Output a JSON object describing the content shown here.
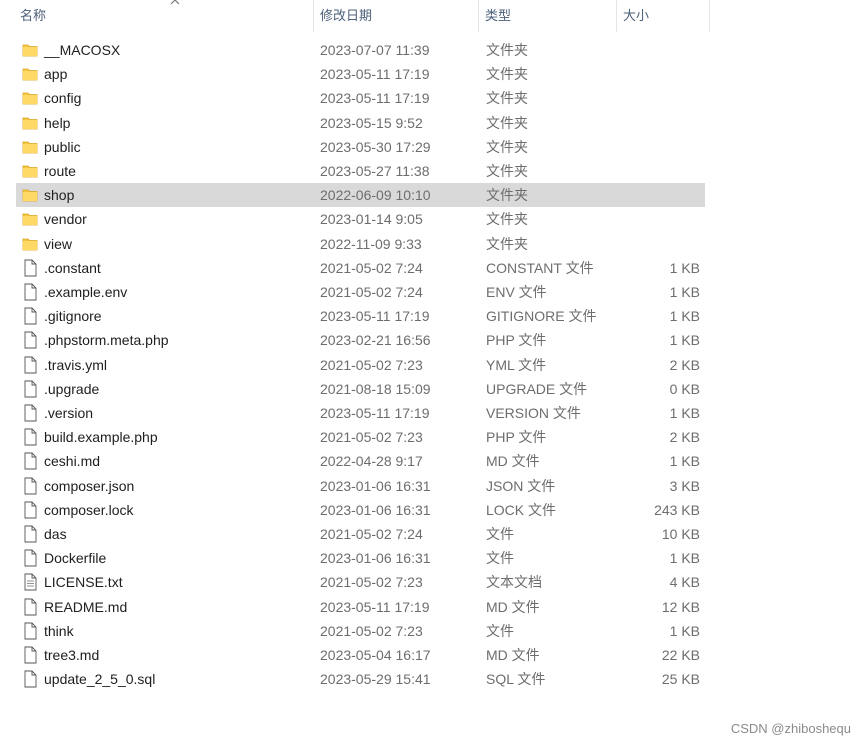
{
  "header": {
    "name": "名称",
    "date": "修改日期",
    "type": "类型",
    "size": "大小"
  },
  "colors": {
    "folder": "#f5c542",
    "selected_row": "#d9d9d9",
    "header_text": "#4c607a"
  },
  "files": [
    {
      "name": "__MACOSX",
      "date": "2023-07-07 11:39",
      "type": "文件夹",
      "size": "",
      "icon": "folder-icon"
    },
    {
      "name": "app",
      "date": "2023-05-11 17:19",
      "type": "文件夹",
      "size": "",
      "icon": "folder-icon"
    },
    {
      "name": "config",
      "date": "2023-05-11 17:19",
      "type": "文件夹",
      "size": "",
      "icon": "folder-icon"
    },
    {
      "name": "help",
      "date": "2023-05-15 9:52",
      "type": "文件夹",
      "size": "",
      "icon": "folder-icon"
    },
    {
      "name": "public",
      "date": "2023-05-30 17:29",
      "type": "文件夹",
      "size": "",
      "icon": "folder-icon"
    },
    {
      "name": "route",
      "date": "2023-05-27 11:38",
      "type": "文件夹",
      "size": "",
      "icon": "folder-icon"
    },
    {
      "name": "shop",
      "date": "2022-06-09 10:10",
      "type": "文件夹",
      "size": "",
      "icon": "folder-icon",
      "selected": true
    },
    {
      "name": "vendor",
      "date": "2023-01-14 9:05",
      "type": "文件夹",
      "size": "",
      "icon": "folder-icon"
    },
    {
      "name": "view",
      "date": "2022-11-09 9:33",
      "type": "文件夹",
      "size": "",
      "icon": "folder-icon"
    },
    {
      "name": ".constant",
      "date": "2021-05-02 7:24",
      "type": "CONSTANT 文件",
      "size": "1 KB",
      "icon": "file-icon"
    },
    {
      "name": ".example.env",
      "date": "2021-05-02 7:24",
      "type": "ENV 文件",
      "size": "1 KB",
      "icon": "file-icon"
    },
    {
      "name": ".gitignore",
      "date": "2023-05-11 17:19",
      "type": "GITIGNORE 文件",
      "size": "1 KB",
      "icon": "file-icon"
    },
    {
      "name": ".phpstorm.meta.php",
      "date": "2023-02-21 16:56",
      "type": "PHP 文件",
      "size": "1 KB",
      "icon": "file-icon"
    },
    {
      "name": ".travis.yml",
      "date": "2021-05-02 7:23",
      "type": "YML 文件",
      "size": "2 KB",
      "icon": "file-icon"
    },
    {
      "name": ".upgrade",
      "date": "2021-08-18 15:09",
      "type": "UPGRADE 文件",
      "size": "0 KB",
      "icon": "file-icon"
    },
    {
      "name": ".version",
      "date": "2023-05-11 17:19",
      "type": "VERSION 文件",
      "size": "1 KB",
      "icon": "file-icon"
    },
    {
      "name": "build.example.php",
      "date": "2021-05-02 7:23",
      "type": "PHP 文件",
      "size": "2 KB",
      "icon": "file-icon"
    },
    {
      "name": "ceshi.md",
      "date": "2022-04-28 9:17",
      "type": "MD 文件",
      "size": "1 KB",
      "icon": "file-icon"
    },
    {
      "name": "composer.json",
      "date": "2023-01-06 16:31",
      "type": "JSON 文件",
      "size": "3 KB",
      "icon": "file-icon"
    },
    {
      "name": "composer.lock",
      "date": "2023-01-06 16:31",
      "type": "LOCK 文件",
      "size": "243 KB",
      "icon": "file-icon"
    },
    {
      "name": "das",
      "date": "2021-05-02 7:24",
      "type": "文件",
      "size": "10 KB",
      "icon": "file-icon"
    },
    {
      "name": "Dockerfile",
      "date": "2023-01-06 16:31",
      "type": "文件",
      "size": "1 KB",
      "icon": "file-icon"
    },
    {
      "name": "LICENSE.txt",
      "date": "2021-05-02 7:23",
      "type": "文本文档",
      "size": "4 KB",
      "icon": "text-file-icon"
    },
    {
      "name": "README.md",
      "date": "2023-05-11 17:19",
      "type": "MD 文件",
      "size": "12 KB",
      "icon": "file-icon"
    },
    {
      "name": "think",
      "date": "2021-05-02 7:23",
      "type": "文件",
      "size": "1 KB",
      "icon": "file-icon"
    },
    {
      "name": "tree3.md",
      "date": "2023-05-04 16:17",
      "type": "MD 文件",
      "size": "22 KB",
      "icon": "file-icon"
    },
    {
      "name": "update_2_5_0.sql",
      "date": "2023-05-29 15:41",
      "type": "SQL 文件",
      "size": "25 KB",
      "icon": "file-icon"
    }
  ],
  "watermark": "CSDN @zhiboshequ"
}
